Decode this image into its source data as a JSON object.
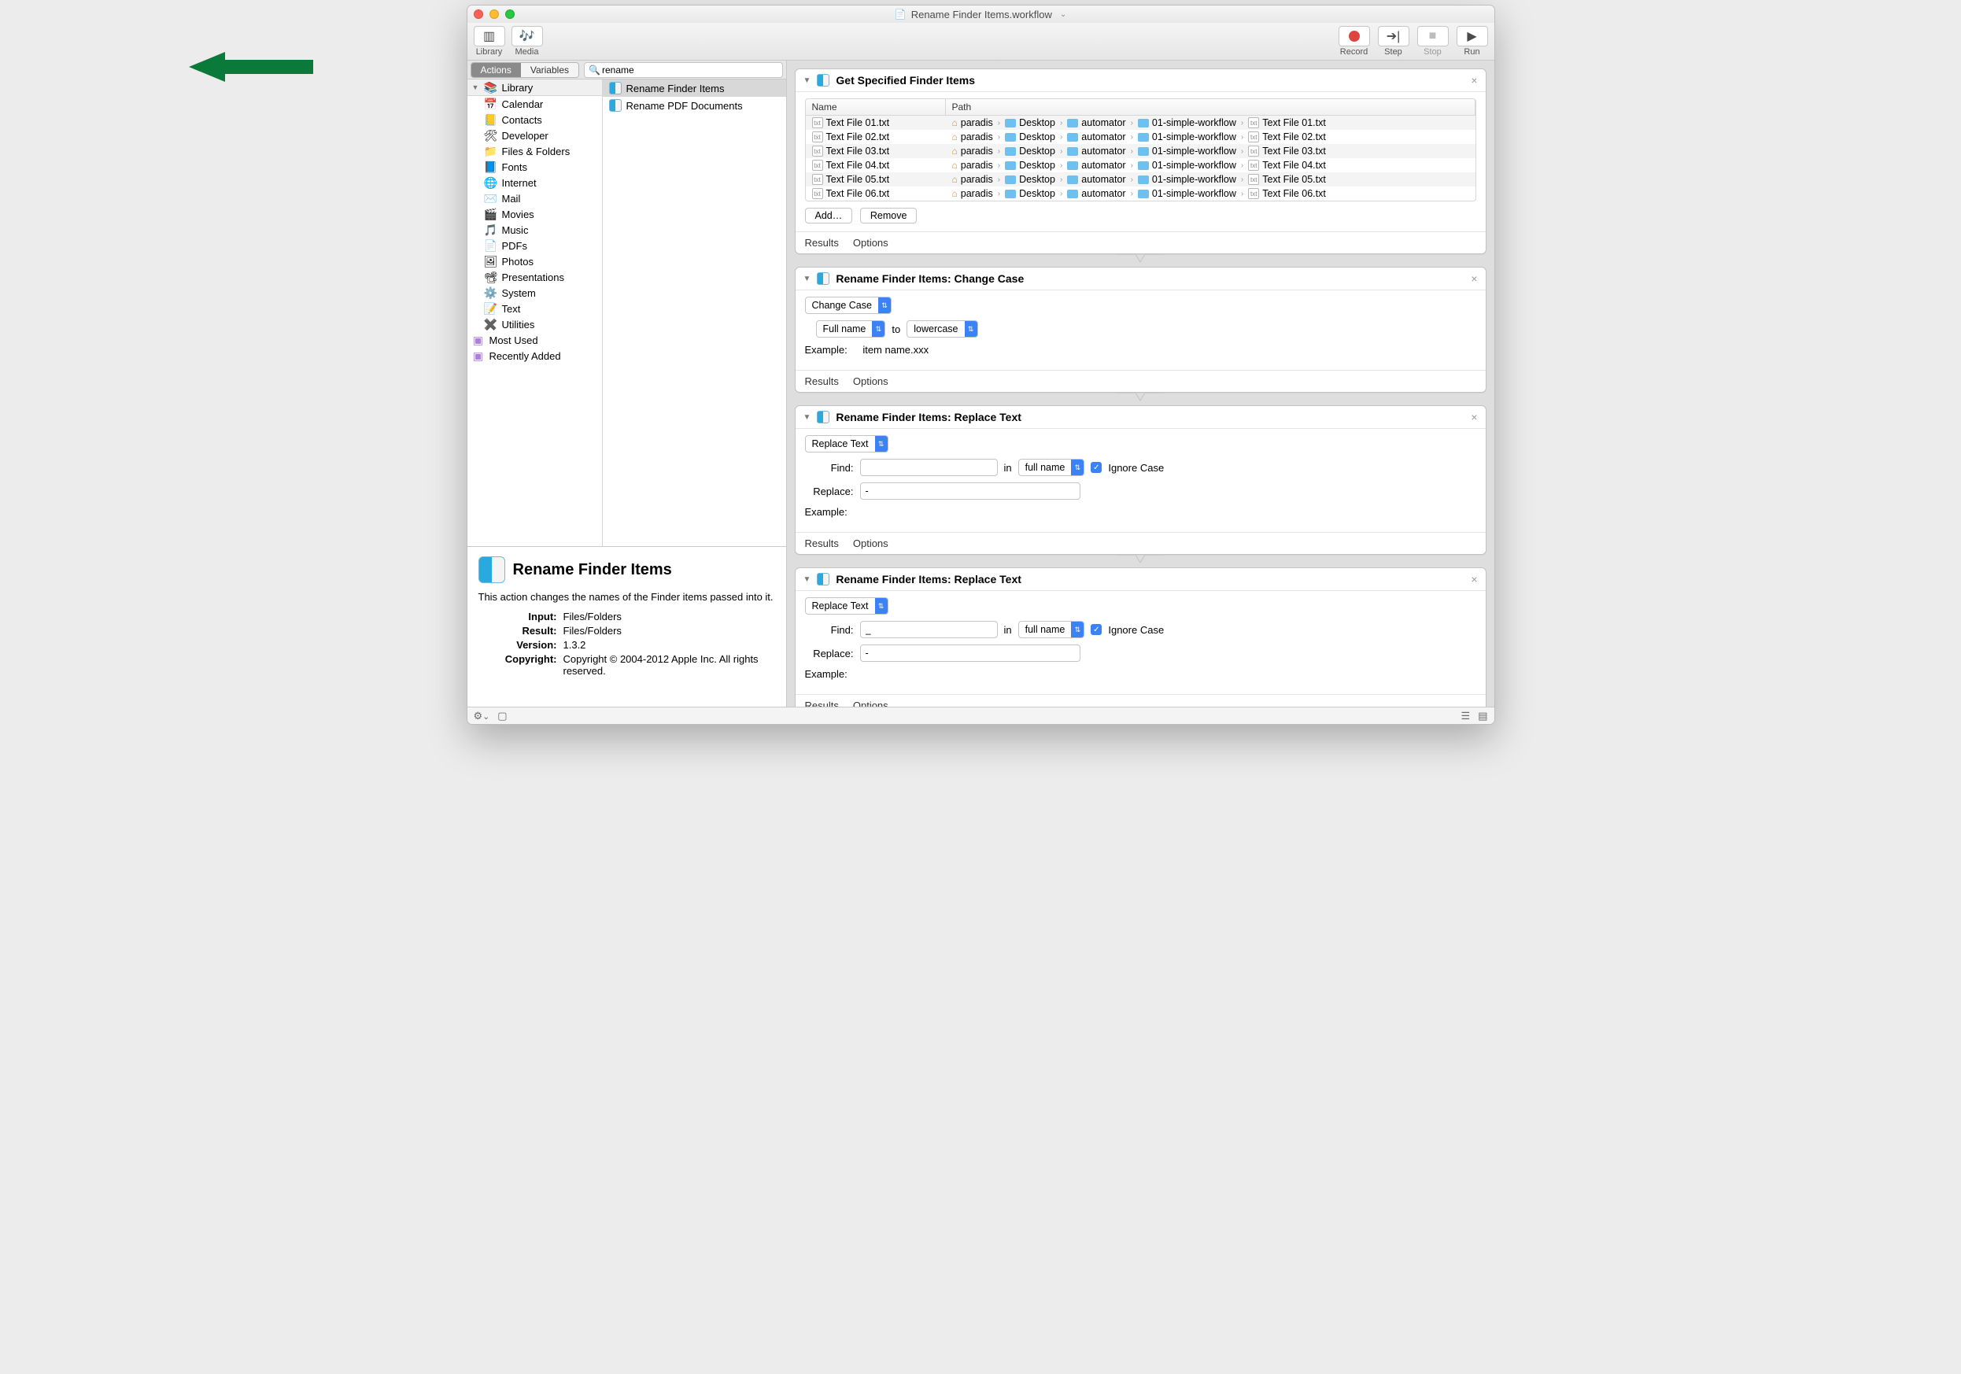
{
  "title": "Rename Finder Items.workflow",
  "toolbar": {
    "library": "Library",
    "media": "Media",
    "record": "Record",
    "step": "Step",
    "stop": "Stop",
    "run": "Run"
  },
  "seg": {
    "actions": "Actions",
    "variables": "Variables"
  },
  "search": {
    "value": "rename"
  },
  "library": {
    "head": "Library",
    "items": [
      {
        "label": "Calendar",
        "icon": "📅"
      },
      {
        "label": "Contacts",
        "icon": "📒"
      },
      {
        "label": "Developer",
        "icon": "🛠"
      },
      {
        "label": "Files & Folders",
        "icon": "📁"
      },
      {
        "label": "Fonts",
        "icon": "📘"
      },
      {
        "label": "Internet",
        "icon": "🌐"
      },
      {
        "label": "Mail",
        "icon": "✉️"
      },
      {
        "label": "Movies",
        "icon": "🎬"
      },
      {
        "label": "Music",
        "icon": "🎵"
      },
      {
        "label": "PDFs",
        "icon": "📄"
      },
      {
        "label": "Photos",
        "icon": "🖼"
      },
      {
        "label": "Presentations",
        "icon": "📽"
      },
      {
        "label": "System",
        "icon": "⚙️"
      },
      {
        "label": "Text",
        "icon": "📝"
      },
      {
        "label": "Utilities",
        "icon": "✖️"
      }
    ],
    "extras": [
      {
        "label": "Most Used"
      },
      {
        "label": "Recently Added"
      }
    ]
  },
  "results": [
    {
      "label": "Rename Finder Items"
    },
    {
      "label": "Rename PDF Documents"
    }
  ],
  "info": {
    "title": "Rename Finder Items",
    "desc": "This action changes the names of the Finder items passed into it.",
    "rows": {
      "Input": "Files/Folders",
      "Result": "Files/Folders",
      "Version": "1.3.2",
      "Copyright": "Copyright © 2004-2012 Apple Inc.  All rights reserved."
    }
  },
  "wf": {
    "a1": {
      "title": "Get Specified Finder Items",
      "cols": {
        "name": "Name",
        "path": "Path"
      },
      "rows": [
        {
          "name": "Text File 01.txt",
          "file": "Text File 01.txt"
        },
        {
          "name": "Text File 02.txt",
          "file": "Text File 02.txt"
        },
        {
          "name": "Text File 03.txt",
          "file": "Text File 03.txt"
        },
        {
          "name": "Text File 04.txt",
          "file": "Text File 04.txt"
        },
        {
          "name": "Text File 05.txt",
          "file": "Text File 05.txt"
        },
        {
          "name": "Text File 06.txt",
          "file": "Text File 06.txt"
        }
      ],
      "path_user": "paradis",
      "path_segs": [
        "Desktop",
        "automator",
        "01-simple-workflow"
      ],
      "add": "Add…",
      "remove": "Remove"
    },
    "a2": {
      "title": "Rename Finder Items: Change Case",
      "mode": "Change Case",
      "scope": "Full name",
      "to": "to",
      "case": "lowercase",
      "example_lbl": "Example:",
      "example": "item name.xxx"
    },
    "a3": {
      "title": "Rename Finder Items: Replace Text",
      "mode": "Replace Text",
      "find_lbl": "Find:",
      "find": "",
      "in": "in",
      "in_v": "full name",
      "ignore": "Ignore Case",
      "replace_lbl": "Replace:",
      "replace": "-",
      "example_lbl": "Example:"
    },
    "a4": {
      "title": "Rename Finder Items: Replace Text",
      "mode": "Replace Text",
      "find_lbl": "Find:",
      "find": "_",
      "in": "in",
      "in_v": "full name",
      "ignore": "Ignore Case",
      "replace_lbl": "Replace:",
      "replace": "-",
      "example_lbl": "Example:"
    },
    "foot": {
      "results": "Results",
      "options": "Options"
    }
  }
}
